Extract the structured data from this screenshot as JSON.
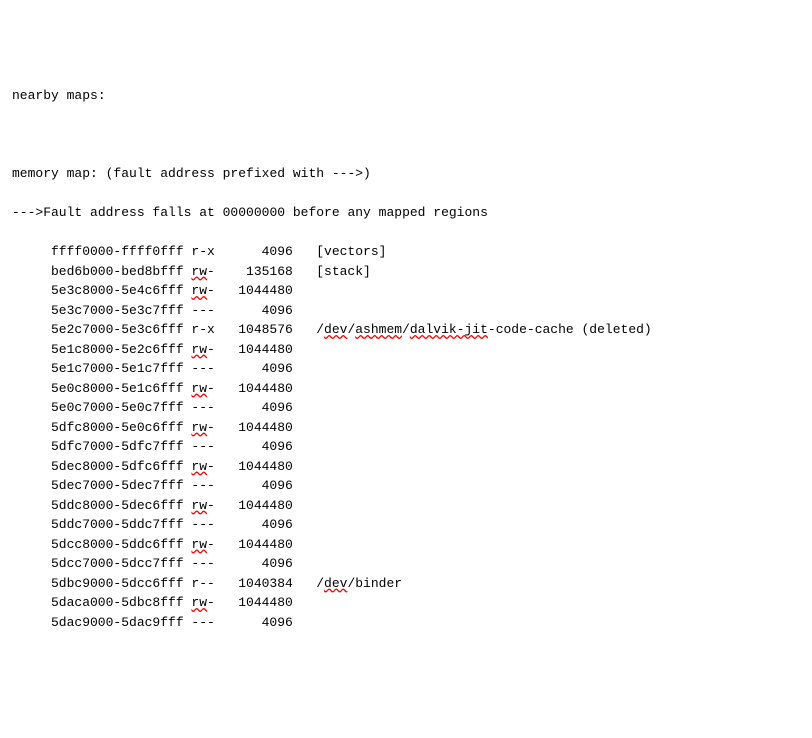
{
  "header": {
    "line1": "nearby maps:",
    "blank": " ",
    "line2": "memory map: (fault address prefixed with --->)",
    "line3": "--->Fault address falls at 00000000 before any mapped regions"
  },
  "rows": [
    {
      "range": "ffff0000-ffff0fff",
      "perm": {
        "pre": "r-x",
        "u": "",
        "post": ""
      },
      "size": "4096",
      "path": {
        "segs": [
          {
            "t": "[vectors]",
            "u": false
          }
        ]
      }
    },
    {
      "range": "bed6b000-bed8bfff",
      "perm": {
        "pre": "",
        "u": "rw",
        "post": "-"
      },
      "size": "135168",
      "path": {
        "segs": [
          {
            "t": "[stack]",
            "u": false
          }
        ]
      }
    },
    {
      "range": "5e3c8000-5e4c6fff",
      "perm": {
        "pre": "",
        "u": "rw",
        "post": "-"
      },
      "size": "1044480",
      "path": {
        "segs": []
      }
    },
    {
      "range": "5e3c7000-5e3c7fff",
      "perm": {
        "pre": "---",
        "u": "",
        "post": ""
      },
      "size": "4096",
      "path": {
        "segs": []
      }
    },
    {
      "range": "5e2c7000-5e3c6fff",
      "perm": {
        "pre": "r-x",
        "u": "",
        "post": ""
      },
      "size": "1048576",
      "path": {
        "segs": [
          {
            "t": "/",
            "u": false
          },
          {
            "t": "dev",
            "u": true
          },
          {
            "t": "/",
            "u": false
          },
          {
            "t": "ashmem",
            "u": true
          },
          {
            "t": "/",
            "u": false
          },
          {
            "t": "dalvik-jit",
            "u": true
          },
          {
            "t": "-code-cache (deleted)",
            "u": false
          }
        ]
      }
    },
    {
      "range": "5e1c8000-5e2c6fff",
      "perm": {
        "pre": "",
        "u": "rw",
        "post": "-"
      },
      "size": "1044480",
      "path": {
        "segs": []
      }
    },
    {
      "range": "5e1c7000-5e1c7fff",
      "perm": {
        "pre": "---",
        "u": "",
        "post": ""
      },
      "size": "4096",
      "path": {
        "segs": []
      }
    },
    {
      "range": "5e0c8000-5e1c6fff",
      "perm": {
        "pre": "",
        "u": "rw",
        "post": "-"
      },
      "size": "1044480",
      "path": {
        "segs": []
      }
    },
    {
      "range": "5e0c7000-5e0c7fff",
      "perm": {
        "pre": "---",
        "u": "",
        "post": ""
      },
      "size": "4096",
      "path": {
        "segs": []
      }
    },
    {
      "range": "5dfc8000-5e0c6fff",
      "perm": {
        "pre": "",
        "u": "rw",
        "post": "-"
      },
      "size": "1044480",
      "path": {
        "segs": []
      }
    },
    {
      "range": "5dfc7000-5dfc7fff",
      "perm": {
        "pre": "---",
        "u": "",
        "post": ""
      },
      "size": "4096",
      "path": {
        "segs": []
      }
    },
    {
      "range": "5dec8000-5dfc6fff",
      "perm": {
        "pre": "",
        "u": "rw",
        "post": "-"
      },
      "size": "1044480",
      "path": {
        "segs": []
      }
    },
    {
      "range": "5dec7000-5dec7fff",
      "perm": {
        "pre": "---",
        "u": "",
        "post": ""
      },
      "size": "4096",
      "path": {
        "segs": []
      }
    },
    {
      "range": "5ddc8000-5dec6fff",
      "perm": {
        "pre": "",
        "u": "rw",
        "post": "-"
      },
      "size": "1044480",
      "path": {
        "segs": []
      }
    },
    {
      "range": "5ddc7000-5ddc7fff",
      "perm": {
        "pre": "---",
        "u": "",
        "post": ""
      },
      "size": "4096",
      "path": {
        "segs": []
      }
    },
    {
      "range": "5dcc8000-5ddc6fff",
      "perm": {
        "pre": "",
        "u": "rw",
        "post": "-"
      },
      "size": "1044480",
      "path": {
        "segs": []
      }
    },
    {
      "range": "5dcc7000-5dcc7fff",
      "perm": {
        "pre": "---",
        "u": "",
        "post": ""
      },
      "size": "4096",
      "path": {
        "segs": []
      }
    },
    {
      "range": "5dbc9000-5dcc6fff",
      "perm": {
        "pre": "r--",
        "u": "",
        "post": ""
      },
      "size": "1040384",
      "path": {
        "segs": [
          {
            "t": "/",
            "u": false
          },
          {
            "t": "dev",
            "u": true
          },
          {
            "t": "/binder",
            "u": false
          }
        ]
      }
    },
    {
      "range": "5daca000-5dbc8fff",
      "perm": {
        "pre": "",
        "u": "rw",
        "post": "-"
      },
      "size": "1044480",
      "path": {
        "segs": []
      }
    },
    {
      "range": "5dac9000-5dac9fff",
      "perm": {
        "pre": "---",
        "u": "",
        "post": ""
      },
      "size": "4096",
      "path": {
        "segs": []
      }
    }
  ]
}
